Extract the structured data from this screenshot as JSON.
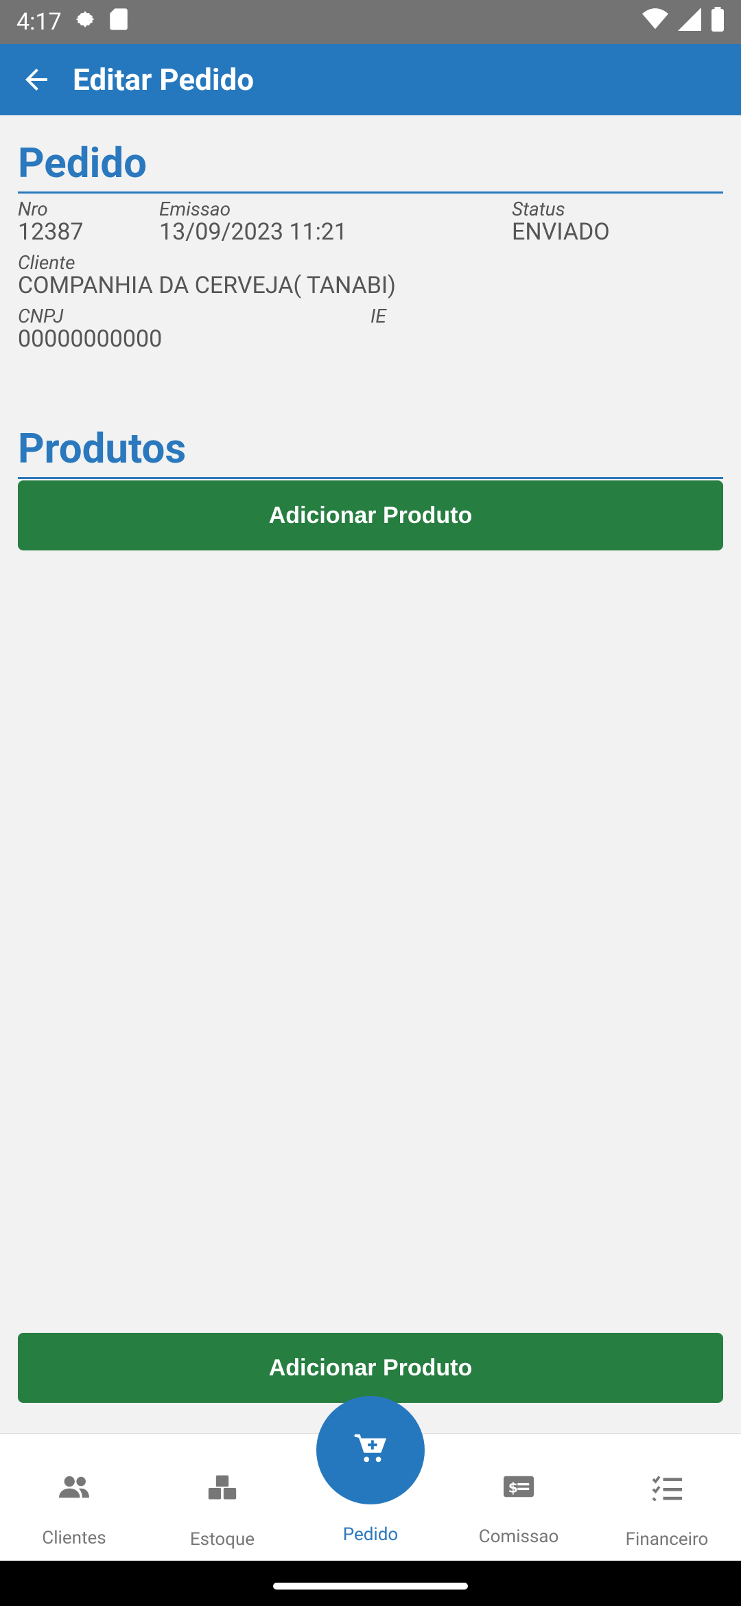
{
  "status_bar": {
    "time": "4:17"
  },
  "app_bar": {
    "title": "Editar Pedido"
  },
  "pedido": {
    "section_title": "Pedido",
    "nro_label": "Nro",
    "nro_value": "12387",
    "emissao_label": "Emissao",
    "emissao_value": "13/09/2023 11:21",
    "status_label": "Status",
    "status_value": "ENVIADO",
    "cliente_label": "Cliente",
    "cliente_value": "COMPANHIA DA CERVEJA( TANABI)",
    "cnpj_label": "CNPJ",
    "cnpj_value": "00000000000",
    "ie_label": "IE",
    "ie_value": ""
  },
  "produtos": {
    "section_title": "Produtos",
    "add_button_top": "Adicionar Produto",
    "add_button_bottom": "Adicionar Produto"
  },
  "bottom_nav": {
    "items": [
      {
        "label": "Clientes",
        "icon": "people-icon"
      },
      {
        "label": "Estoque",
        "icon": "boxes-icon"
      },
      {
        "label": "Pedido",
        "icon": "cart-add-icon",
        "active": true
      },
      {
        "label": "Comissao",
        "icon": "money-icon"
      },
      {
        "label": "Financeiro",
        "icon": "checklist-icon"
      }
    ]
  },
  "colors": {
    "primary": "#2678be",
    "green": "#267e40",
    "background": "#f2f2f2"
  }
}
